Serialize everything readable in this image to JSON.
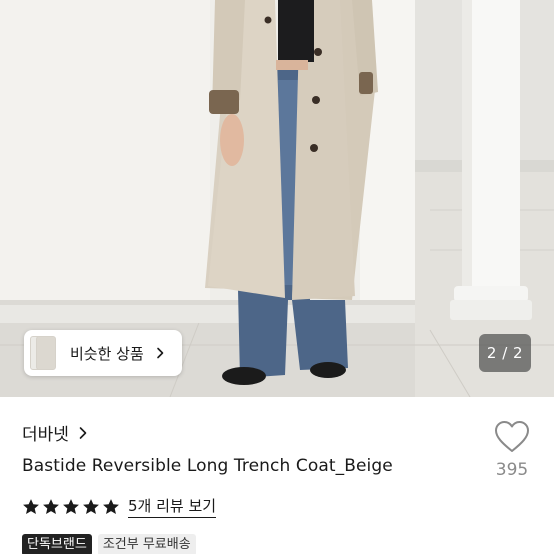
{
  "photo": {
    "similar_products_label": "비슷한 상품",
    "page_indicator": "2 / 2"
  },
  "product": {
    "brand": "더바넷",
    "title": "Bastide Reversible Long Trench Coat_Beige",
    "like_count": "395",
    "rating": 5,
    "review_link": "5개 리뷰 보기"
  },
  "badges": [
    "단독브랜드",
    "조건부 무료배송"
  ],
  "icons": {
    "brand": "chevron-right-icon",
    "like": "heart-outline-icon",
    "rating": "star-filled-icon",
    "similar": "chevron-right-icon"
  },
  "colors": {
    "text_primary": "#1a1a1a",
    "text_muted": "#8a8a8a",
    "badge_dark": "#222222",
    "badge_light": "#eeeeee"
  }
}
